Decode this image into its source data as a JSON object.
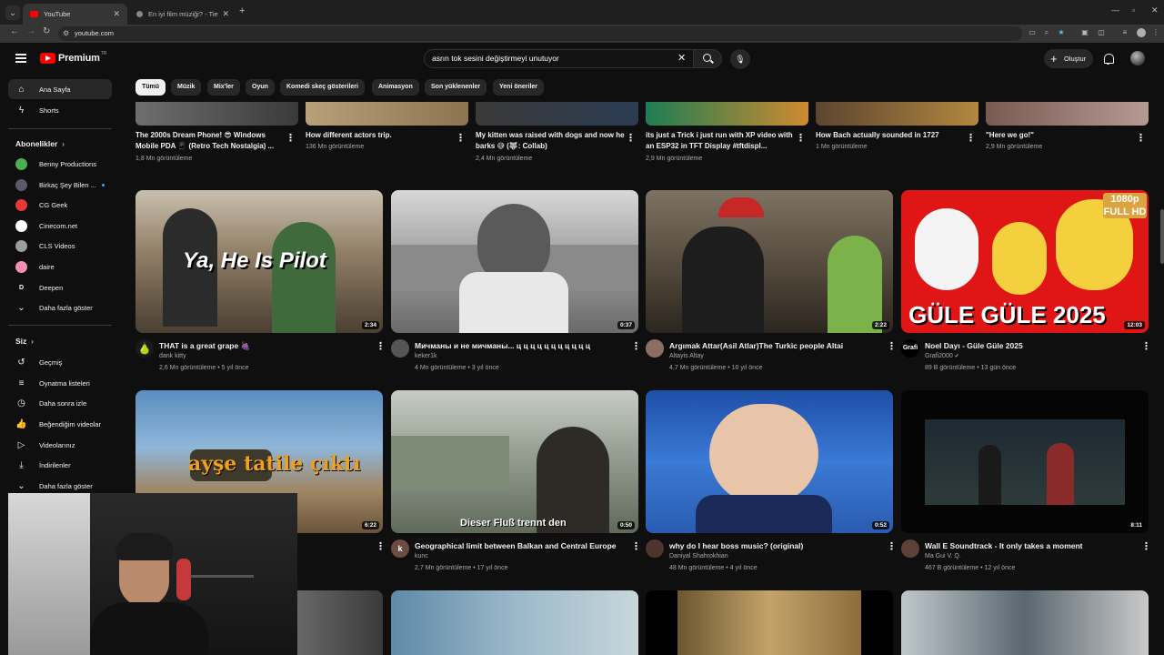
{
  "browser": {
    "tabs": [
      {
        "label": "YouTube",
        "active": true
      },
      {
        "label": "En iyi film müziği? - Tier List, Ki",
        "active": false
      }
    ],
    "url": "youtube.com"
  },
  "header": {
    "logo_text": "Premium",
    "logo_sup": "TR",
    "search_value": "asrın tok sesini değiştirmeyi unutuyor",
    "create_label": "Oluştur"
  },
  "sidebar": {
    "top": [
      {
        "label": "Ana Sayfa",
        "icon": "home-icon"
      },
      {
        "label": "Shorts",
        "icon": "shorts-icon"
      }
    ],
    "subscriptions_heading": "Abonelikler",
    "subscriptions": [
      {
        "label": "Benny Productions",
        "color": "#4caf50"
      },
      {
        "label": "Birkaç Şey Bilen ...",
        "color": "#5a5a6a",
        "dot": true
      },
      {
        "label": "CG Geek",
        "color": "#e53935"
      },
      {
        "label": "Cinecom.net",
        "color": "#ffffff"
      },
      {
        "label": "CLS Videos",
        "color": "#9e9e9e"
      },
      {
        "label": "daire",
        "color": "#f48fb1"
      },
      {
        "label": "Deepen",
        "color": "#0f0f0f",
        "initial": "D"
      }
    ],
    "show_more": "Daha fazla göster",
    "you_heading": "Siz",
    "you_items": [
      {
        "label": "Geçmiş",
        "icon": "history-icon"
      },
      {
        "label": "Oynatma listeleri",
        "icon": "playlists-icon"
      },
      {
        "label": "Daha sonra izle",
        "icon": "watch-later-icon"
      },
      {
        "label": "Beğendiğim videolar",
        "icon": "liked-videos-icon"
      },
      {
        "label": "Videolarınız",
        "icon": "your-videos-icon"
      },
      {
        "label": "İndirilenler",
        "icon": "downloads-icon"
      }
    ],
    "you_show_more": "Daha fazla göster"
  },
  "chips": [
    "Tümü",
    "Müzik",
    "Mix'ler",
    "Oyun",
    "Komedi skeç gösterileri",
    "Animasyon",
    "Son yüklenenler",
    "Yeni öneriler"
  ],
  "row0": [
    {
      "title": "The 2000s Dream Phone! 😎 Windows Mobile PDA 📱 (Retro Tech Nostalgia) ...",
      "meta": "1,8 Mn görüntüleme"
    },
    {
      "title": "How different actors trip.",
      "meta": "136 Mn görüntüleme"
    },
    {
      "title": "My kitten was raised with dogs and now he barks 😅 (🐺: Collab)",
      "meta": "2,4 Mn görüntüleme"
    },
    {
      "title": "its just a Trick i just run with XP video with an ESP32 in TFT Display #tftdispl...",
      "meta": "2,9 Mn görüntüleme"
    },
    {
      "title": "How Bach actually sounded in 1727",
      "meta": "1 Mn görüntüleme"
    },
    {
      "title": "\"Here we go!\"",
      "meta": "2,9 Mn görüntüleme"
    }
  ],
  "row1": [
    {
      "title": "THAT is a great grape 🍇",
      "channel": "dank kitty",
      "views": "2,6 Mn görüntüleme",
      "age": "5 yıl önce",
      "duration": "2:34",
      "overlay": "Ya, He Is Pilot"
    },
    {
      "title": "Мичманы и не мичманы... ц ц ц ц ц ц ц ц ц ц ц",
      "channel": "keker1k",
      "views": "4 Mn görüntüleme",
      "age": "3 yıl önce",
      "duration": "0:37"
    },
    {
      "title": "Argımak Attar(Asil Atlar)The Turkic people Altai",
      "channel": "Altayis Altay",
      "views": "4,7 Mn görüntüleme",
      "age": "10 yıl önce",
      "duration": "2:22"
    },
    {
      "title": "Noel Dayı - Güle Güle 2025",
      "channel": "Grafi2000",
      "views": "89 B görüntüleme",
      "age": "13 gün önce",
      "duration": "12:03",
      "overlay": "GÜLE GÜLE 2025",
      "badge": "1080p FULL HD",
      "verified": true,
      "avatar_text": "Grafi"
    }
  ],
  "row2": [
    {
      "duration": "6:22",
      "overlay": "ayşe tatile çıktı"
    },
    {
      "title": "Geographical limit between Balkan and Central Europe",
      "channel": "kunc",
      "views": "2,7 Mn görüntüleme",
      "age": "17 yıl önce",
      "duration": "0:50",
      "overlay": "Dieser Fluß trennt den",
      "avatar_text": "k"
    },
    {
      "title": "why do I hear boss music? (original)",
      "channel": "Daniyal Shahrokhian",
      "views": "48 Mn görüntüleme",
      "age": "4 yıl önce",
      "duration": "0:52"
    },
    {
      "title": "Wall E Soundtrack - It only takes a moment",
      "channel": "Ma Gui V. Q.",
      "views": "467 B görüntüleme",
      "age": "12 yıl önce",
      "duration": "8:11"
    }
  ]
}
